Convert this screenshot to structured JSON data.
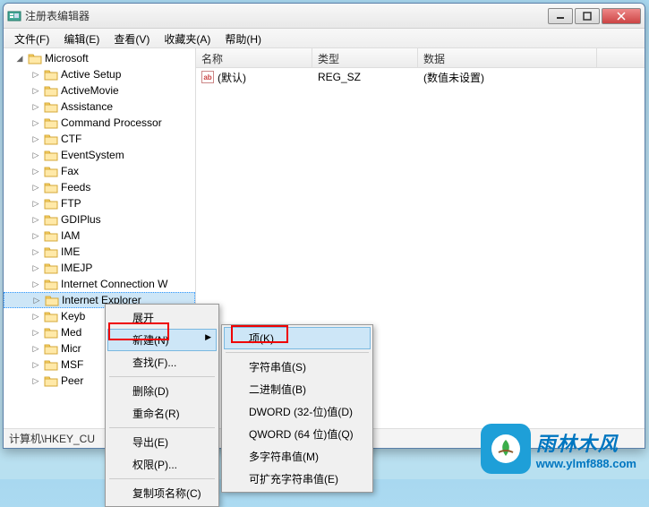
{
  "window": {
    "title": "注册表编辑器"
  },
  "menubar": {
    "file": "文件(F)",
    "edit": "编辑(E)",
    "view": "查看(V)",
    "favorites": "收藏夹(A)",
    "help": "帮助(H)"
  },
  "tree": {
    "root": "Microsoft",
    "items": [
      "Active Setup",
      "ActiveMovie",
      "Assistance",
      "Command Processor",
      "CTF",
      "EventSystem",
      "Fax",
      "Feeds",
      "FTP",
      "GDIPlus",
      "IAM",
      "IME",
      "IMEJP",
      "Internet Connection W",
      "Internet Explorer",
      "Keyb",
      "Med",
      "Micr",
      "MSF",
      "Peer"
    ]
  },
  "list": {
    "headers": {
      "name": "名称",
      "type": "类型",
      "data": "数据"
    },
    "rows": [
      {
        "name": "(默认)",
        "type": "REG_SZ",
        "data": "(数值未设置)"
      }
    ]
  },
  "statusbar": {
    "path": "计算机\\HKEY_CU"
  },
  "context1": {
    "expand": "展开",
    "new": "新建(N)",
    "find": "查找(F)...",
    "delete": "删除(D)",
    "rename": "重命名(R)",
    "export": "导出(E)",
    "permissions": "权限(P)...",
    "copykey": "复制项名称(C)"
  },
  "context2": {
    "key": "项(K)",
    "string": "字符串值(S)",
    "binary": "二进制值(B)",
    "dword": "DWORD (32-位)值(D)",
    "qword": "QWORD (64 位)值(Q)",
    "multi": "多字符串值(M)",
    "expand": "可扩充字符串值(E)"
  },
  "watermark": {
    "cn": "雨林木风",
    "url": "www.ylmf888.com"
  }
}
